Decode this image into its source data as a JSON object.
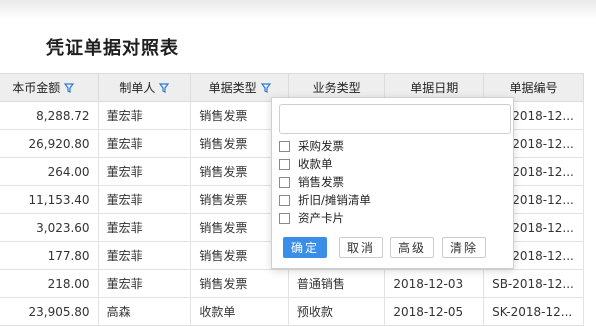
{
  "page": {
    "title": "凭证单据对照表"
  },
  "table": {
    "columns": [
      {
        "label": "本币金额",
        "filter": true
      },
      {
        "label": "制单人",
        "filter": true
      },
      {
        "label": "单据类型",
        "filter": true
      },
      {
        "label": "业务类型",
        "filter": false
      },
      {
        "label": "单据日期",
        "filter": false
      },
      {
        "label": "单据编号",
        "filter": false
      }
    ],
    "rows": [
      [
        "8,288.72",
        "董宏菲",
        "销售发票",
        "",
        "",
        "SB-2018-12..."
      ],
      [
        "26,920.80",
        "董宏菲",
        "销售发票",
        "",
        "",
        "SB-2018-12..."
      ],
      [
        "264.00",
        "董宏菲",
        "销售发票",
        "",
        "",
        "SB-2018-12..."
      ],
      [
        "11,153.40",
        "董宏菲",
        "销售发票",
        "",
        "",
        "SB-2018-12..."
      ],
      [
        "3,023.60",
        "董宏菲",
        "销售发票",
        "",
        "",
        "SB-2018-12..."
      ],
      [
        "177.80",
        "董宏菲",
        "销售发票",
        "",
        "",
        "SB-2018-12..."
      ],
      [
        "218.00",
        "董宏菲",
        "销售发票",
        "普通销售",
        "2018-12-03",
        "SB-2018-12..."
      ],
      [
        "23,905.80",
        "高森",
        "收款单",
        "预收款",
        "2018-12-05",
        "SK-2018-12..."
      ]
    ]
  },
  "filter_popup": {
    "search_value": "",
    "options": [
      "采购发票",
      "收款单",
      "销售发票",
      "折旧/摊销清单",
      "资产卡片"
    ],
    "buttons": {
      "confirm": "确定",
      "cancel": "取消",
      "advanced": "高级",
      "clear": "清除"
    }
  },
  "colors": {
    "accent": "#3b8ee8",
    "link": "#2b6cb0",
    "header_bg": "#eeeeee"
  }
}
